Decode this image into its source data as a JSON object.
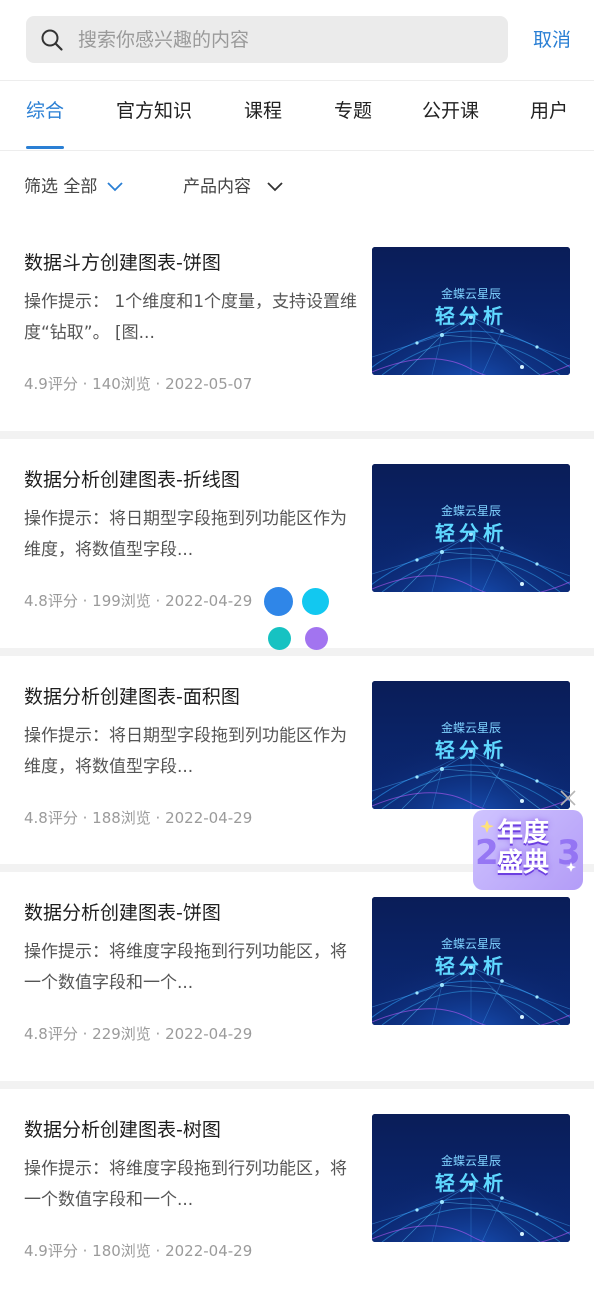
{
  "search": {
    "placeholder": "搜索你感兴趣的内容",
    "cancel_label": "取消"
  },
  "tabs": [
    {
      "label": "综合",
      "active": true
    },
    {
      "label": "官方知识"
    },
    {
      "label": "课程"
    },
    {
      "label": "专题"
    },
    {
      "label": "公开课"
    },
    {
      "label": "用户"
    }
  ],
  "filters": {
    "filter_label": "筛选 全部",
    "product_label": "产品内容"
  },
  "thumbnail": {
    "brand": "金蝶云星辰",
    "title": "轻分析"
  },
  "items": [
    {
      "title": "数据斗方创建图表-饼图",
      "desc": "操作提示： 1个维度和1个度量，支持设置维度“钻取”。 [图...",
      "meta": "4.9评分 · 140浏览 · 2022-05-07"
    },
    {
      "title": "数据分析创建图表-折线图",
      "desc": "操作提示：将日期型字段拖到列功能区作为维度，将数值型字段...",
      "meta": "4.8评分 · 199浏览 · 2022-04-29"
    },
    {
      "title": "数据分析创建图表-面积图",
      "desc": "操作提示：将日期型字段拖到列功能区作为维度，将数值型字段...",
      "meta": "4.8评分 · 188浏览 · 2022-04-29"
    },
    {
      "title": "数据分析创建图表-饼图",
      "desc": "操作提示：将维度字段拖到行列功能区，将一个数值字段和一个...",
      "meta": "4.8评分 · 229浏览 · 2022-04-29"
    },
    {
      "title": "数据分析创建图表-树图",
      "desc": "操作提示：将维度字段拖到行列功能区，将一个数值字段和一个...",
      "meta": "4.9评分 · 180浏览 · 2022-04-29"
    }
  ],
  "badge": {
    "text": "年度盛典"
  },
  "colors": {
    "accent": "#2a7fd4",
    "dot_blue": "#2f86e8",
    "dot_cyan": "#12c8f0",
    "dot_teal": "#16c2c2",
    "dot_purple": "#a274f0"
  }
}
